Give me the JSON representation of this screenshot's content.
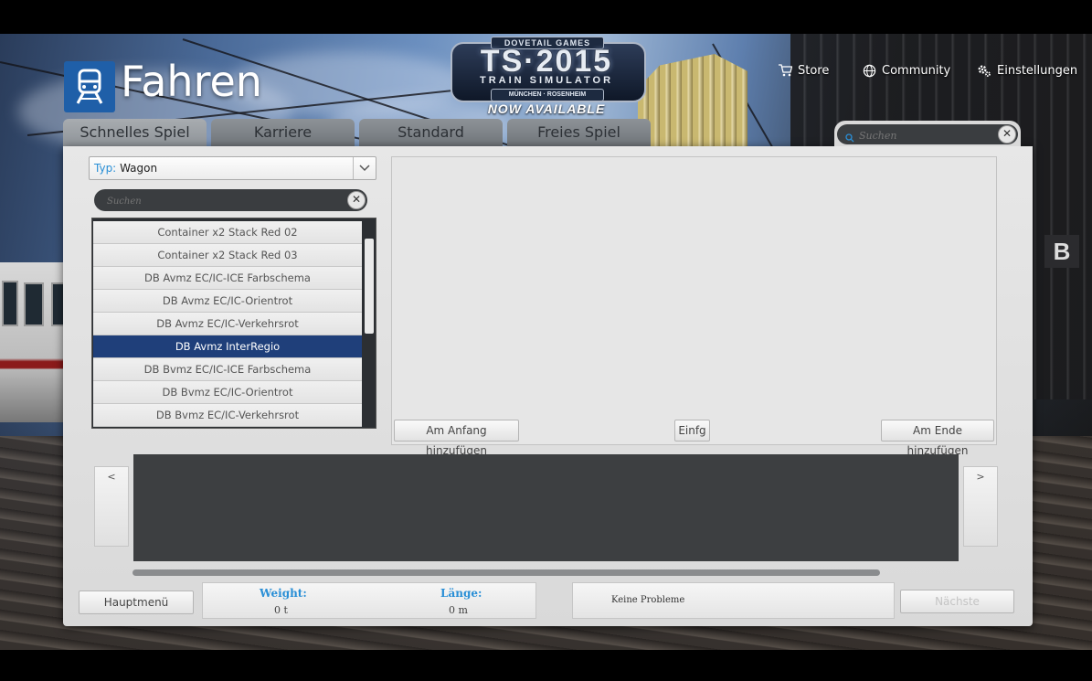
{
  "header": {
    "title": "Fahren",
    "nav": {
      "store": "Store",
      "community": "Community",
      "settings": "Einstellungen"
    }
  },
  "logo": {
    "publisher": "DOVETAIL GAMES",
    "title": "TS·2015",
    "subtitle": "TRAIN SIMULATOR",
    "route": "MÜNCHEN · ROSENHEIM",
    "tagline": "NOW AVAILABLE"
  },
  "tabs": [
    {
      "label": "Schnelles Spiel",
      "active": true
    },
    {
      "label": "Karriere",
      "active": false
    },
    {
      "label": "Standard",
      "active": false
    },
    {
      "label": "Freies Spiel",
      "active": false
    }
  ],
  "top_search": {
    "placeholder": "Suchen"
  },
  "filter": {
    "type_label": "Typ:",
    "type_value": "Wagon"
  },
  "list_search": {
    "placeholder": "Suchen"
  },
  "wagons": [
    {
      "label": "Container x2 Stack Red 02",
      "selected": false
    },
    {
      "label": "Container x2 Stack Red 03",
      "selected": false
    },
    {
      "label": "DB Avmz EC/IC-ICE Farbschema",
      "selected": false
    },
    {
      "label": "DB Avmz EC/IC-Orientrot",
      "selected": false
    },
    {
      "label": "DB Avmz EC/IC-Verkehrsrot",
      "selected": false
    },
    {
      "label": "DB Avmz InterRegio",
      "selected": true
    },
    {
      "label": "DB Bvmz EC/IC-ICE Farbschema",
      "selected": false
    },
    {
      "label": "DB Bvmz EC/IC-Orientrot",
      "selected": false
    },
    {
      "label": "DB Bvmz EC/IC-Verkehrsrot",
      "selected": false
    }
  ],
  "preview": {
    "add_start": "Am Anfang hinzufügen",
    "insert": "Einfg",
    "add_end": "Am Ende hinzufügen"
  },
  "consist_nav": {
    "prev": "<",
    "next": ">"
  },
  "footer": {
    "main_menu": "Hauptmenü",
    "weight_label": "Weight:",
    "weight_value": "0 t",
    "length_label": "Länge:",
    "length_value": "0 m",
    "status": "Keine Probleme",
    "next": "Nächste"
  },
  "colors": {
    "accent": "#2a8fd6",
    "selection": "#1f3f7a",
    "header_icon": "#1f5fa8"
  }
}
